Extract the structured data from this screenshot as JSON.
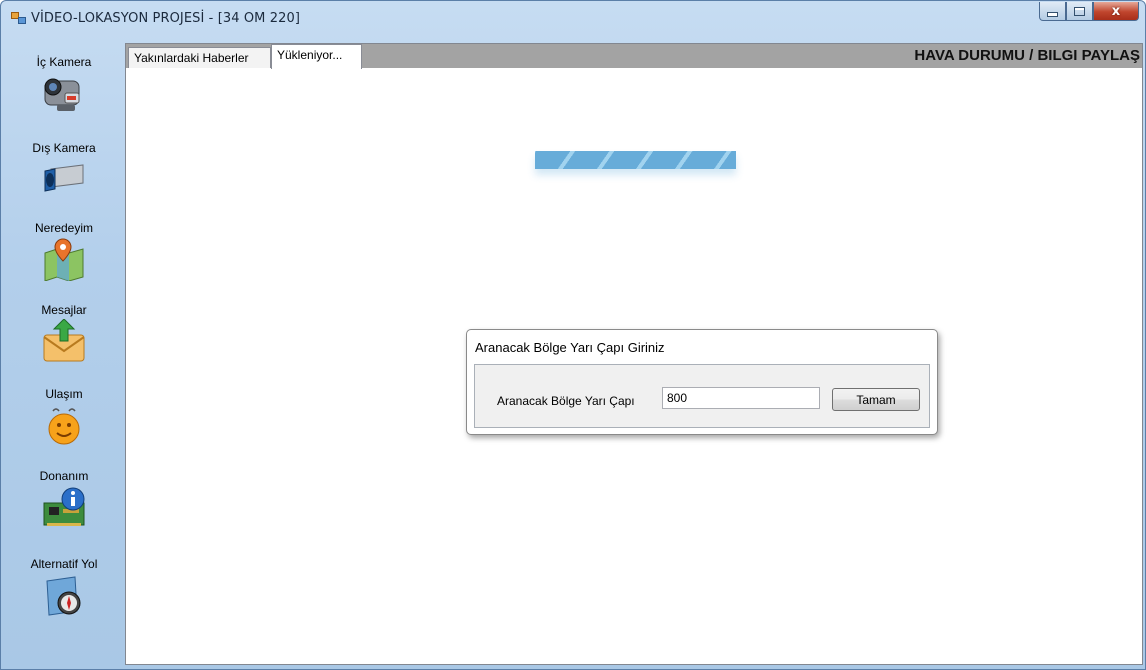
{
  "window": {
    "title": "VİDEO-LOKASYON PROJESİ - [34 OM 220]",
    "minimize_icon": "minimize-icon",
    "maximize_icon": "maximize-icon",
    "close_label": "x"
  },
  "sidebar": {
    "items": [
      {
        "label": "İç Kamera",
        "icon": "camcorder-icon"
      },
      {
        "label": "Dış Kamera",
        "icon": "security-camera-icon"
      },
      {
        "label": "Neredeyim",
        "icon": "map-pin-icon"
      },
      {
        "label": "Mesajlar",
        "icon": "mail-icon"
      },
      {
        "label": "Ulaşım",
        "icon": "smiley-icon"
      },
      {
        "label": "Donanım",
        "icon": "hardware-info-icon"
      },
      {
        "label": "Alternatif Yol",
        "icon": "compass-map-icon"
      }
    ]
  },
  "tabs": [
    {
      "label": "Yakınlardaki Haberler"
    },
    {
      "label": "Yükleniyor..."
    }
  ],
  "header": {
    "weather_link": "HAVA DURUMU / BILGI PAYLAŞ"
  },
  "dialog": {
    "title": "Aranacak Bölge Yarı Çapı Giriniz",
    "field_label": "Aranacak Bölge Yarı Çapı",
    "field_value": "800",
    "ok_label": "Tamam"
  },
  "colors": {
    "window_frame": "#b3cfeb",
    "progress": "#5fa8d8",
    "close_button": "#c0452d"
  }
}
